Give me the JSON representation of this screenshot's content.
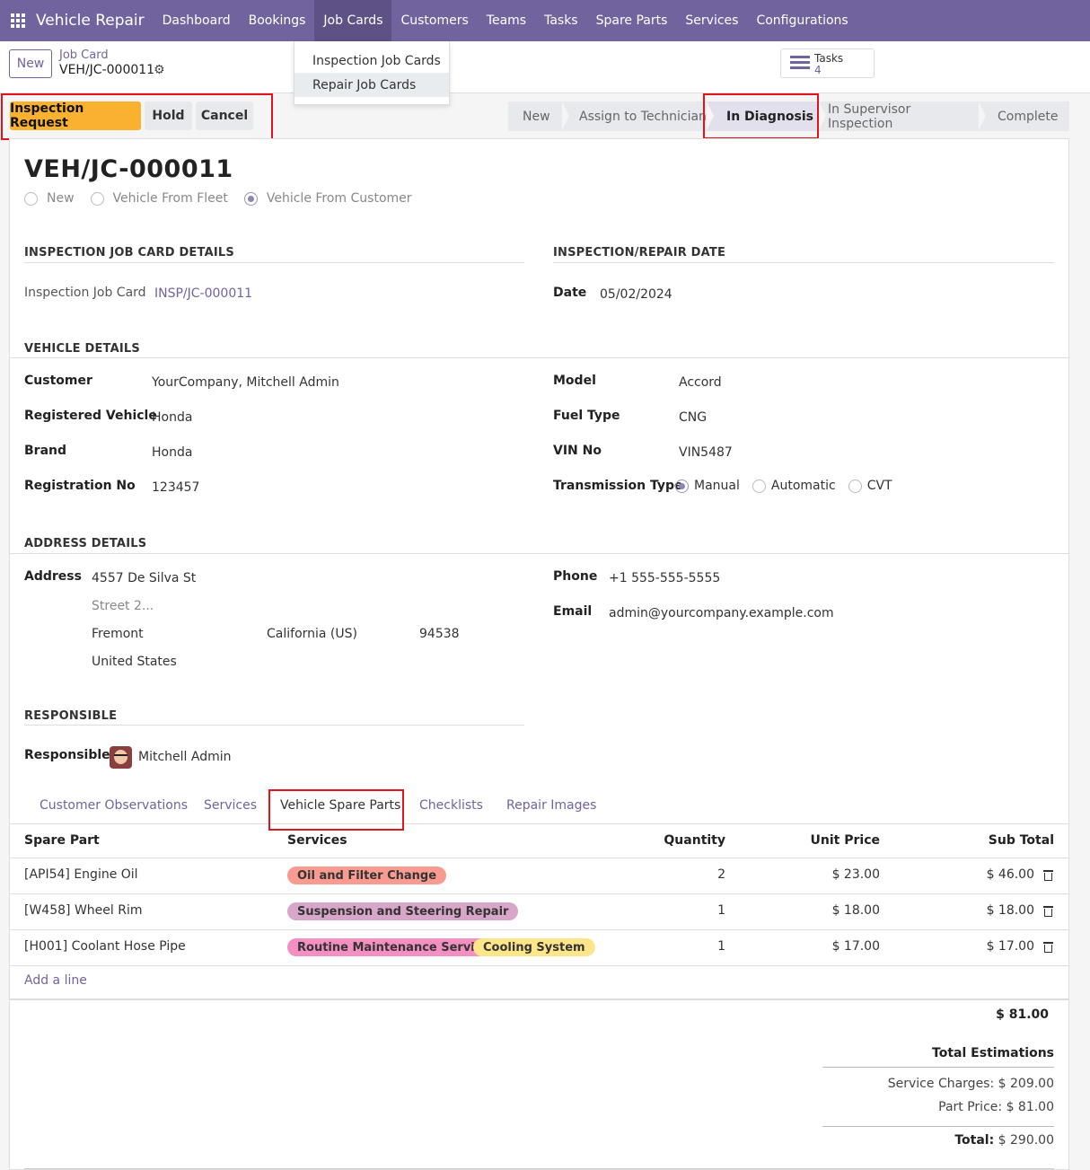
{
  "navbar": {
    "app_name": "Vehicle Repair",
    "items": [
      "Dashboard",
      "Bookings",
      "Job Cards",
      "Customers",
      "Teams",
      "Tasks",
      "Spare Parts",
      "Services",
      "Configurations"
    ]
  },
  "dropdown": {
    "items": [
      "Inspection Job Cards",
      "Repair Job Cards"
    ]
  },
  "control_panel": {
    "new_label": "New",
    "breadcrumb_parent": "Job Card",
    "breadcrumb_current": "VEH/JC-000011",
    "tasks_label": "Tasks",
    "tasks_count": "4"
  },
  "actions": {
    "inspection_request": "Inspection Request",
    "hold": "Hold",
    "cancel": "Cancel"
  },
  "stages": [
    "New",
    "Assign to Technician",
    "In Diagnosis",
    "In Supervisor Inspection",
    "Complete"
  ],
  "form": {
    "title": "VEH/JC-000011",
    "source_options": [
      "New",
      "Vehicle From Fleet",
      "Vehicle From Customer"
    ],
    "inspection_section": "INSPECTION JOB CARD DETAILS",
    "inspection_job_card_label": "Inspection Job Card",
    "inspection_job_card_value": "INSP/JC-000011",
    "date_section": "INSPECTION/REPAIR DATE",
    "date_label": "Date",
    "date_value": "05/02/2024",
    "vehicle_section": "VEHICLE DETAILS",
    "customer_label": "Customer",
    "customer_value": "YourCompany, Mitchell Admin",
    "registered_vehicle_label": "Registered Vehicle",
    "registered_vehicle_value": "Honda",
    "brand_label": "Brand",
    "brand_value": "Honda",
    "registration_label": "Registration No",
    "registration_value": "123457",
    "model_label": "Model",
    "model_value": "Accord",
    "fuel_label": "Fuel Type",
    "fuel_value": "CNG",
    "vin_label": "VIN No",
    "vin_value": "VIN5487",
    "transmission_label": "Transmission Type",
    "transmission_options": [
      "Manual",
      "Automatic",
      "CVT"
    ],
    "address_section": "ADDRESS DETAILS",
    "address_label": "Address",
    "street": "4557 De Silva St",
    "street2_placeholder": "Street 2...",
    "city": "Fremont",
    "state": "California (US)",
    "zip": "94538",
    "country": "United States",
    "phone_label": "Phone",
    "phone_value": "+1 555-555-5555",
    "email_label": "Email",
    "email_value": "admin@yourcompany.example.com",
    "responsible_section": "RESPONSIBLE",
    "responsible_label": "Responsible",
    "responsible_value": "Mitchell Admin"
  },
  "tabs": [
    "Customer Observations",
    "Services",
    "Vehicle Spare Parts",
    "Checklists",
    "Repair Images"
  ],
  "table": {
    "headers": [
      "Spare Part",
      "Services",
      "Quantity",
      "Unit Price",
      "Sub Total"
    ],
    "rows": [
      {
        "part": "[API54] Engine Oil",
        "tags": [
          "Oil and Filter Change"
        ],
        "qty": "2",
        "unit": "$ 23.00",
        "sub": "$ 46.00"
      },
      {
        "part": "[W458] Wheel Rim",
        "tags": [
          "Suspension and Steering Repair"
        ],
        "qty": "1",
        "unit": "$ 18.00",
        "sub": "$ 18.00"
      },
      {
        "part": "[H001] Coolant Hose Pipe",
        "tags": [
          "Routine Maintenance Services",
          "Cooling System"
        ],
        "qty": "1",
        "unit": "$ 17.00",
        "sub": "$ 17.00"
      }
    ],
    "add_line": "Add a line",
    "sum": "$ 81.00"
  },
  "totals": {
    "heading": "Total Estimations",
    "service_label": "Service Charges:",
    "service_value": "$ 209.00",
    "part_label": "Part Price:",
    "part_value": "$ 81.00",
    "total_label": "Total:",
    "total_value": "$ 290.00"
  },
  "colors": {
    "navbar": "#71639e",
    "primary_button": "#fbb130",
    "highlight": "#e1141d",
    "tag_oil": "#f99b91",
    "tag_suspension": "#d7a6c9",
    "tag_routine": "#f48fc2",
    "tag_cooling": "#fde68a"
  }
}
